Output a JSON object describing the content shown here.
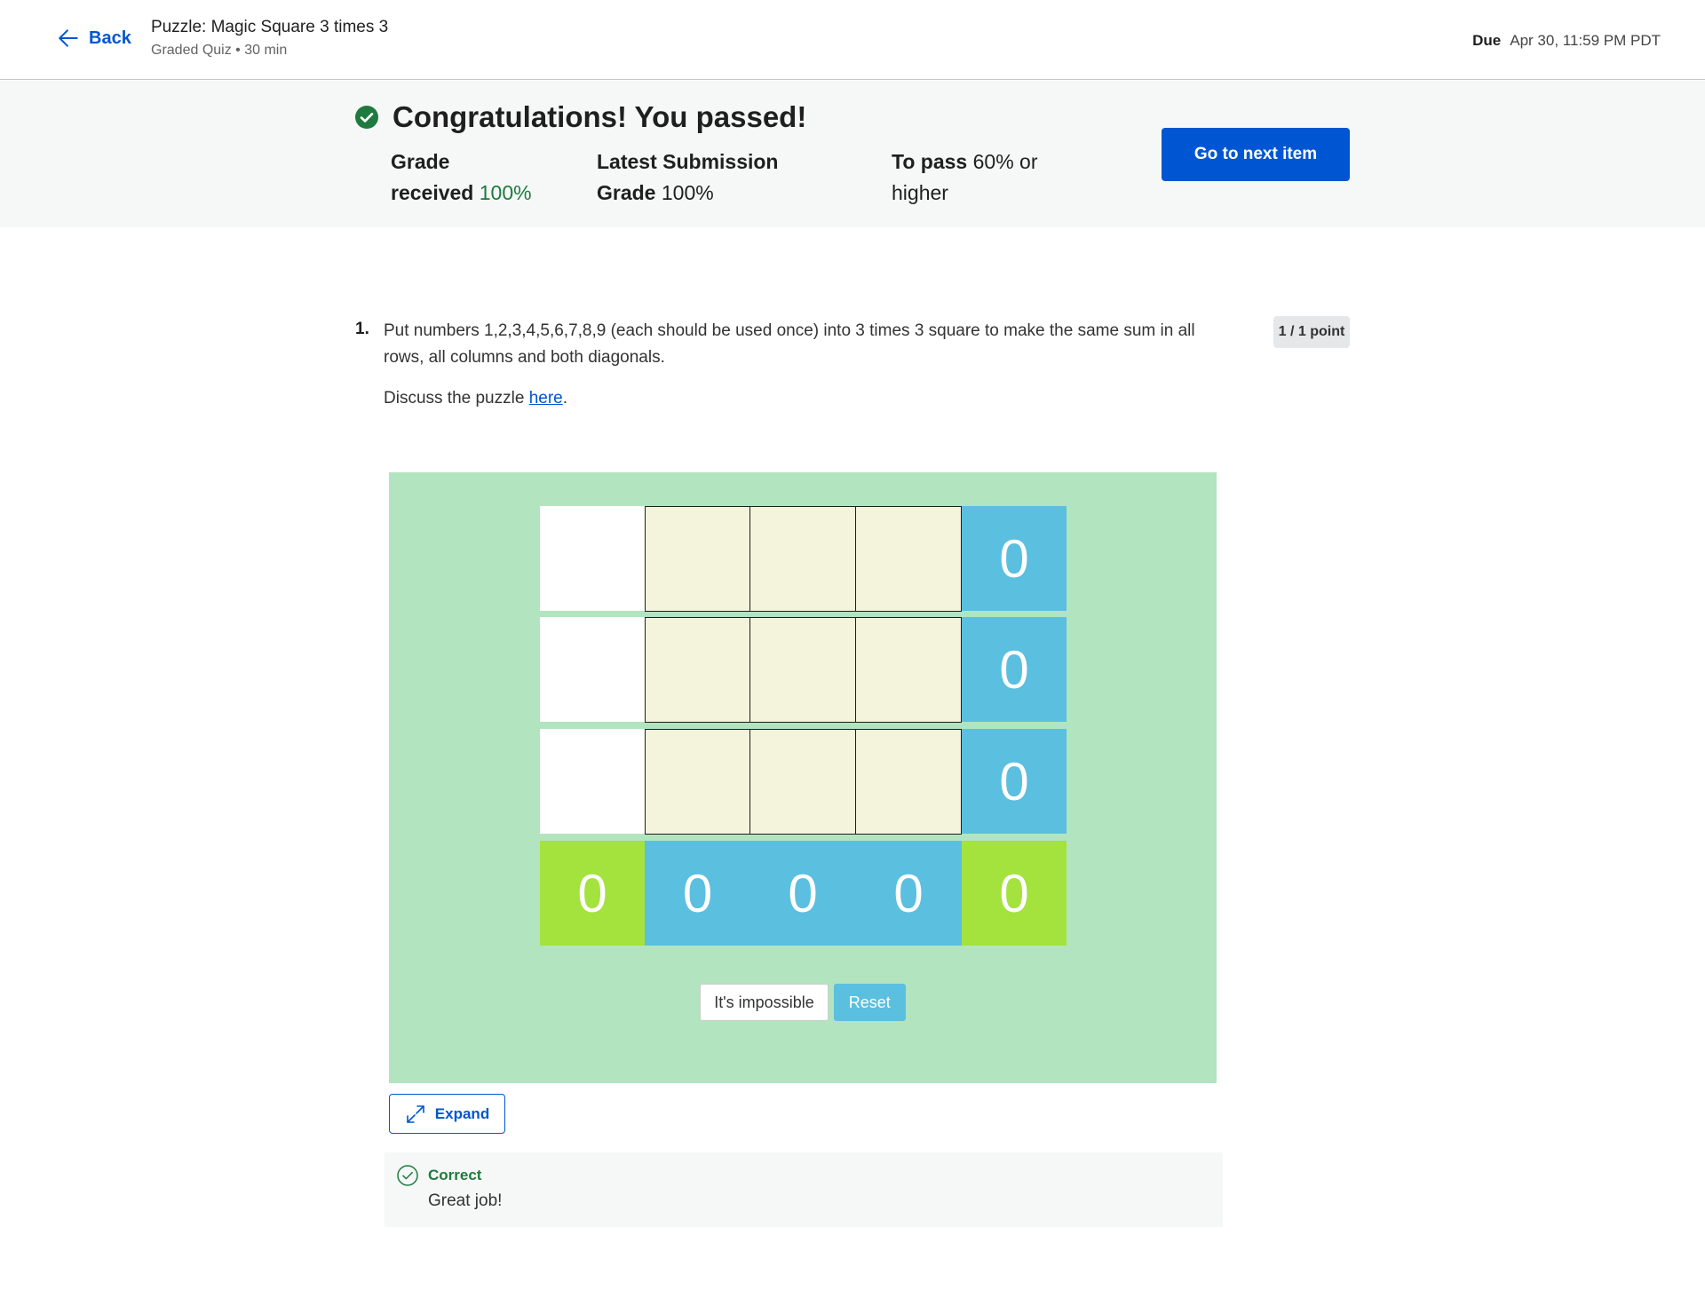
{
  "header": {
    "back_label": "Back",
    "title": "Puzzle: Magic Square 3 times 3",
    "subtitle": "Graded Quiz • 30 min",
    "due_label": "Due",
    "due_value": "Apr 30, 11:59 PM PDT"
  },
  "banner": {
    "title": "Congratulations! You passed!",
    "grade_label_1": "Grade",
    "grade_label_2": "received",
    "grade_value": "100%",
    "latest_label_1": "Latest Submission",
    "latest_label_2": "Grade",
    "latest_value": "100%",
    "pass_label": "To pass",
    "pass_value_1": "60% or",
    "pass_value_2": "higher",
    "next_button": "Go to next item"
  },
  "question": {
    "number": "1.",
    "text": "Put numbers 1,2,3,4,5,6,7,8,9 (each should be used once) into 3 times 3  square to make the same sum in all rows, all columns and both diagonals.",
    "points": "1 / 1 point",
    "discuss_prefix": "Discuss the puzzle ",
    "discuss_link": "here",
    "discuss_suffix": "."
  },
  "puzzle": {
    "row_sums": [
      "0",
      "0",
      "0"
    ],
    "diag_left": "0",
    "col_sums": [
      "0",
      "0",
      "0"
    ],
    "diag_right": "0",
    "impossible_button": "It's impossible",
    "reset_button": "Reset"
  },
  "expand_label": "Expand",
  "feedback": {
    "status": "Correct",
    "message": "Great job!"
  },
  "colors": {
    "accent": "#0056d2",
    "success": "#1f7a3f",
    "puzzle_bg": "#b2e4bf",
    "sum_cell": "#5bbfdf",
    "diag_cell": "#a4e23d",
    "input_cell": "#f4f4dc"
  }
}
